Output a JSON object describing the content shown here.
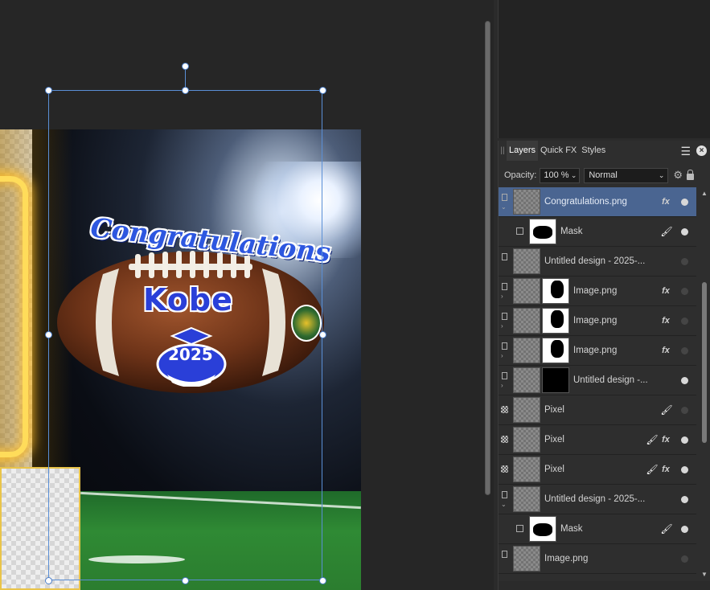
{
  "layers_panel": {
    "tabs": [
      {
        "label": "Layers",
        "active": true
      },
      {
        "label": "Quick FX",
        "active": false
      },
      {
        "label": "Styles",
        "active": false
      }
    ],
    "opacity_label": "Opacity:",
    "opacity_value": "100 %",
    "blend_mode": "Normal",
    "layers": [
      {
        "name": "Congratulations.png",
        "kind": "image",
        "selected": true,
        "fx": true,
        "brush": false,
        "visible": true,
        "expanded": true
      },
      {
        "name": "Mask",
        "kind": "mask",
        "selected": false,
        "fx": false,
        "brush": true,
        "visible": true,
        "child": true
      },
      {
        "name": "Untitled design - 2025-...",
        "kind": "image",
        "selected": false,
        "fx": false,
        "brush": false,
        "visible": false
      },
      {
        "name": "Image.png",
        "kind": "image-masked",
        "selected": false,
        "fx": true,
        "brush": false,
        "visible": false
      },
      {
        "name": "Image.png",
        "kind": "image-masked",
        "selected": false,
        "fx": true,
        "brush": false,
        "visible": false
      },
      {
        "name": "Image.png",
        "kind": "image-masked",
        "selected": false,
        "fx": true,
        "brush": false,
        "visible": false
      },
      {
        "name": "Untitled design -...",
        "kind": "image-masked-dark",
        "selected": false,
        "fx": false,
        "brush": false,
        "visible": true
      },
      {
        "name": "Pixel",
        "kind": "pixel",
        "selected": false,
        "fx": false,
        "brush": true,
        "visible": false
      },
      {
        "name": "Pixel",
        "kind": "pixel",
        "selected": false,
        "fx": true,
        "brush": true,
        "visible": true
      },
      {
        "name": "Pixel",
        "kind": "pixel",
        "selected": false,
        "fx": true,
        "brush": true,
        "visible": true
      },
      {
        "name": "Untitled design - 2025-...",
        "kind": "image",
        "selected": false,
        "fx": false,
        "brush": false,
        "visible": true,
        "expanded": true
      },
      {
        "name": "Mask",
        "kind": "mask",
        "selected": false,
        "fx": false,
        "brush": true,
        "visible": true,
        "child": true
      },
      {
        "name": "Image.png",
        "kind": "image",
        "selected": false,
        "fx": false,
        "brush": false,
        "visible": false
      }
    ]
  },
  "artwork": {
    "congrats_text": "Congratulations",
    "name_text": "Kobe",
    "year_text": "2025"
  },
  "colors": {
    "selection": "#5a8fd6",
    "selected_layer": "#4a6591",
    "panel_bg": "#2e2e2e"
  },
  "icons": [
    "grip-icon",
    "menu-icon",
    "close-icon",
    "gear-icon",
    "lock-icon",
    "fx-icon",
    "brush-icon",
    "visibility-dot-icon",
    "mask-icon",
    "pixel-layer-icon"
  ]
}
